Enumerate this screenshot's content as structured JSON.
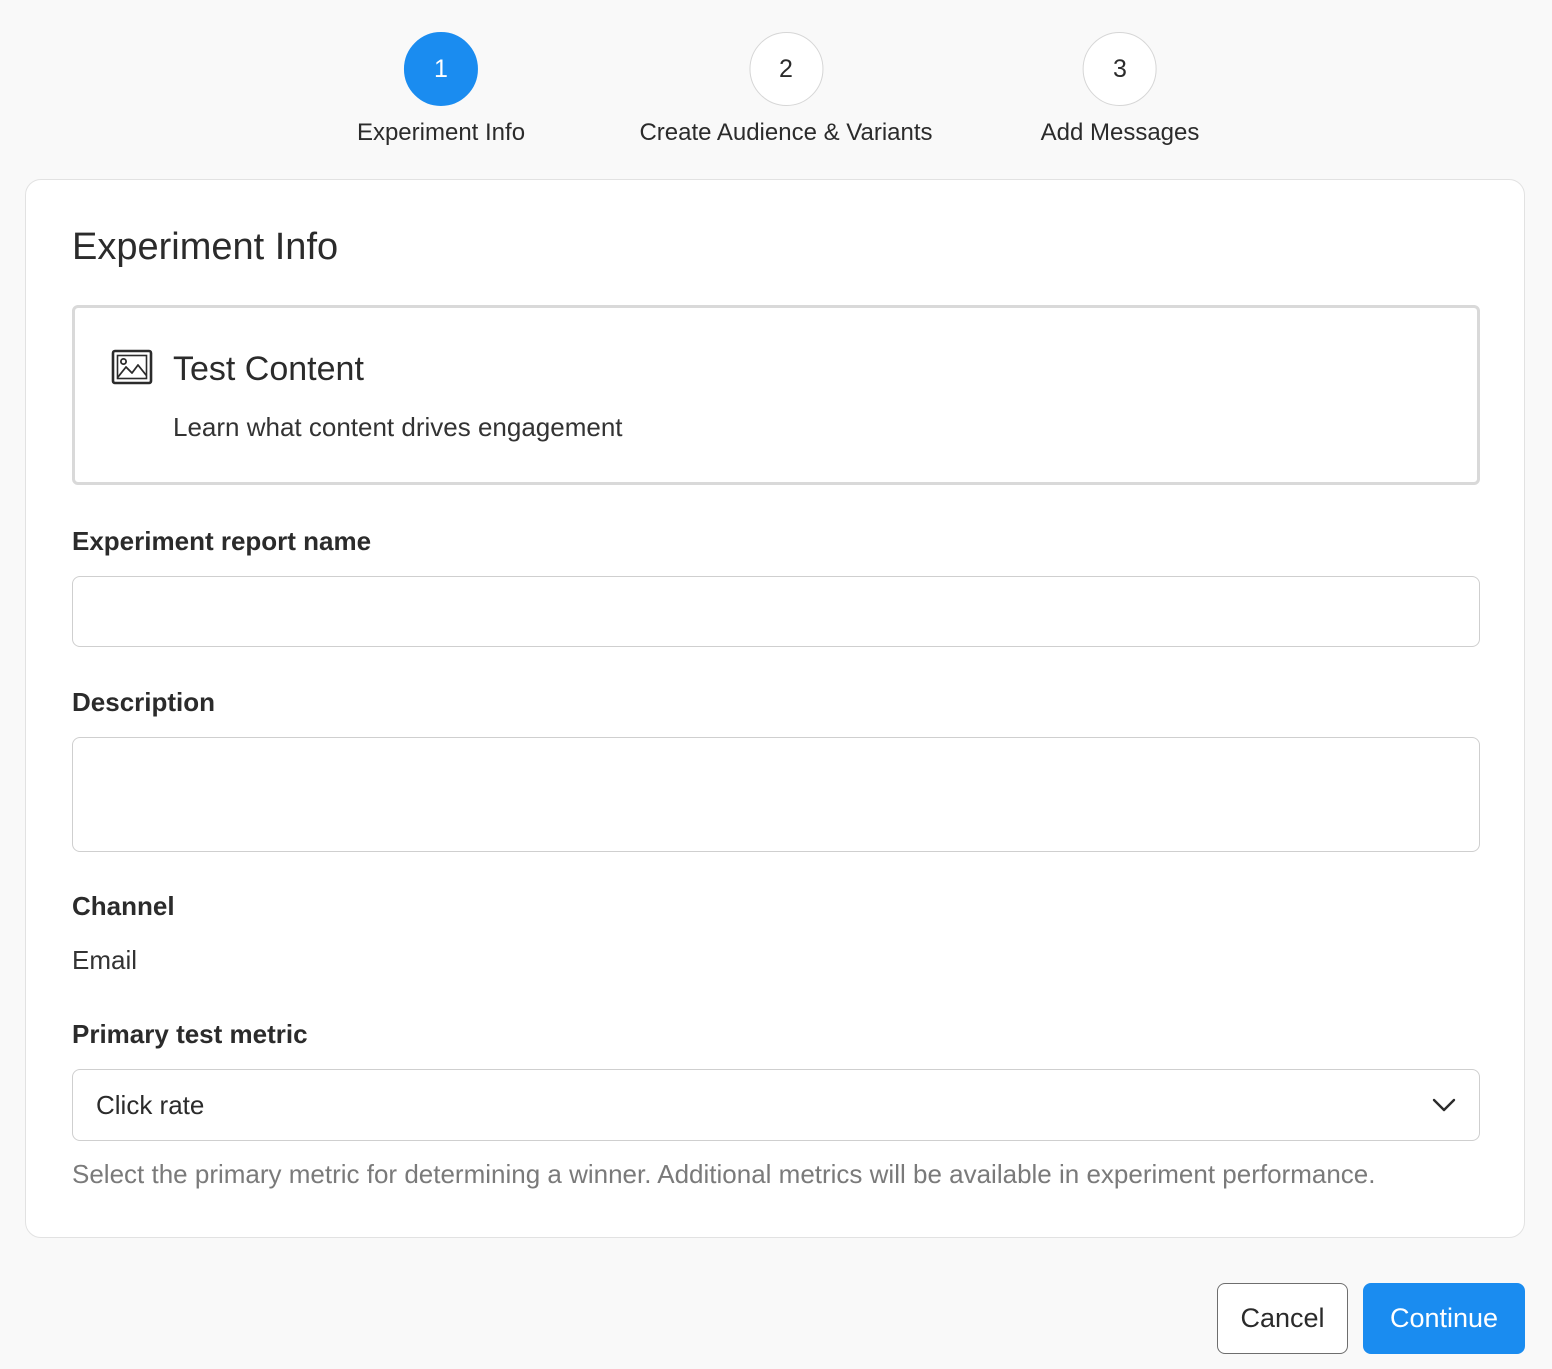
{
  "stepper": {
    "steps": [
      {
        "number": "1",
        "label": "Experiment Info",
        "state": "active"
      },
      {
        "number": "2",
        "label": "Create Audience & Variants",
        "state": "inactive"
      },
      {
        "number": "3",
        "label": "Add Messages",
        "state": "inactive"
      }
    ]
  },
  "card": {
    "title": "Experiment Info",
    "experiment_type": {
      "icon": "image-icon",
      "title": "Test Content",
      "description": "Learn what content drives engagement"
    },
    "report_name": {
      "label": "Experiment report name",
      "value": "",
      "placeholder": ""
    },
    "description": {
      "label": "Description",
      "value": "",
      "placeholder": ""
    },
    "channel": {
      "label": "Channel",
      "value": "Email"
    },
    "primary_metric": {
      "label": "Primary test metric",
      "selected": "Click rate",
      "icon": "chevron-down-icon",
      "helper": "Select the primary metric for determining a winner. Additional metrics will be available in experiment performance."
    }
  },
  "footer": {
    "cancel_label": "Cancel",
    "continue_label": "Continue"
  },
  "colors": {
    "accent": "#1a8cf0",
    "page_background": "#f9f9f9",
    "card_background": "#ffffff",
    "helper_text": "#7a7a7a"
  }
}
